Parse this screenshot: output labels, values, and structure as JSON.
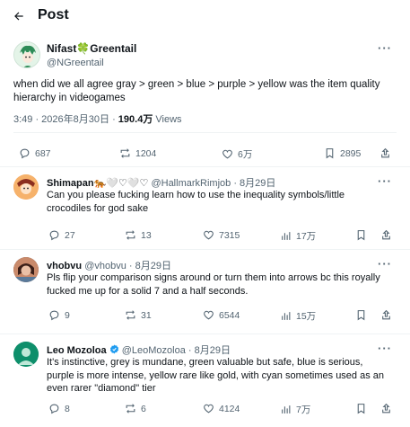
{
  "header": {
    "title": "Post",
    "back_icon": "arrow-left-icon"
  },
  "main_post": {
    "author_name": "Nifast🍀Greentail",
    "author_handle": "@NGreentail",
    "text": "when did we all agree gray > green > blue > purple > yellow was the item quality hierarchy in videogames",
    "time": "3:49 · 2026年8月30日 ·",
    "views_count": "190.4万",
    "views_label": "Views",
    "stats": {
      "replies": "687",
      "reposts": "1204",
      "likes": "6万",
      "bookmarks": "2895"
    }
  },
  "replies": [
    {
      "name": "Shimapan🐅🤍♡🤍♡",
      "handle": "@HallmarkRimjob",
      "date": "· 8月29日",
      "text": "Can you please fucking learn how to use the inequality symbols/little crocodiles for god sake",
      "replies": "27",
      "reposts": "13",
      "likes": "7315",
      "views": "17万"
    },
    {
      "name": "vhobvu",
      "handle": "@vhobvu",
      "date": "· 8月29日",
      "text": "Pls flip your comparison signs around or turn them into arrows bc this royally fucked me up for a solid 7 and a half seconds.",
      "replies": "9",
      "reposts": "31",
      "likes": "6544",
      "views": "15万"
    },
    {
      "name": "Leo Mozoloa",
      "handle": "@LeoMozoloa",
      "date": "· 8月29日",
      "text": "It's instinctive, grey is mundane, green valuable but safe, blue is serious, purple is more intense, yellow rare like gold, with cyan sometimes used as an even rarer \"diamond\" tier",
      "replies": "8",
      "reposts": "6",
      "likes": "4124",
      "views": "7万"
    }
  ],
  "colors": {
    "text": "#0f1419",
    "secondary": "#536471",
    "border": "#eff3f4",
    "verified": "#1d9bf0"
  }
}
